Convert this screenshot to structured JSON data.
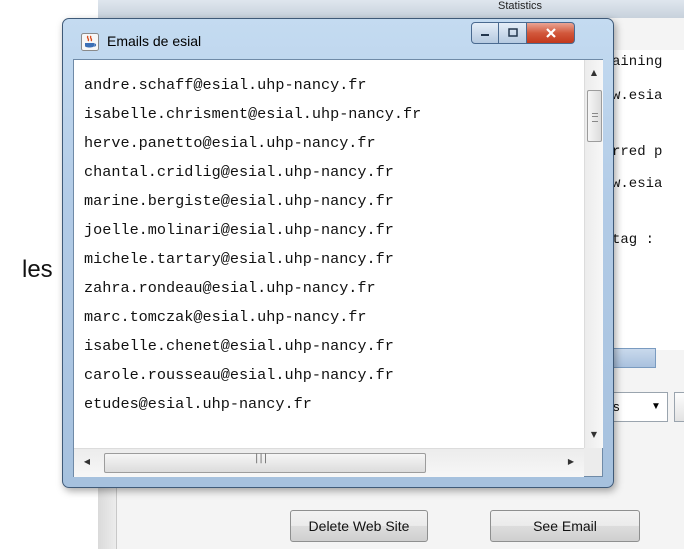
{
  "background_window": {
    "title": "Statistics",
    "side_label": "les",
    "text_fragments": [
      "aining",
      "w.esia",
      "rred p",
      "w.esia",
      "tag :"
    ],
    "combo_value": "s",
    "buttons": {
      "delete_web_site": "Delete Web Site",
      "see_email": "See Email"
    }
  },
  "dialog": {
    "title": "Emails de esial",
    "icons": {
      "app": "java-icon",
      "minimize": "minimize-icon",
      "maximize": "maximize-icon",
      "close": "close-icon"
    },
    "emails": [
      "andre.schaff@esial.uhp-nancy.fr",
      "isabelle.chrisment@esial.uhp-nancy.fr",
      "herve.panetto@esial.uhp-nancy.fr",
      "chantal.cridlig@esial.uhp-nancy.fr",
      "marine.bergiste@esial.uhp-nancy.fr",
      "joelle.molinari@esial.uhp-nancy.fr",
      "michele.tartary@esial.uhp-nancy.fr",
      "zahra.rondeau@esial.uhp-nancy.fr",
      "marc.tomczak@esial.uhp-nancy.fr",
      "isabelle.chenet@esial.uhp-nancy.fr",
      "carole.rousseau@esial.uhp-nancy.fr",
      "etudes@esial.uhp-nancy.fr"
    ]
  }
}
